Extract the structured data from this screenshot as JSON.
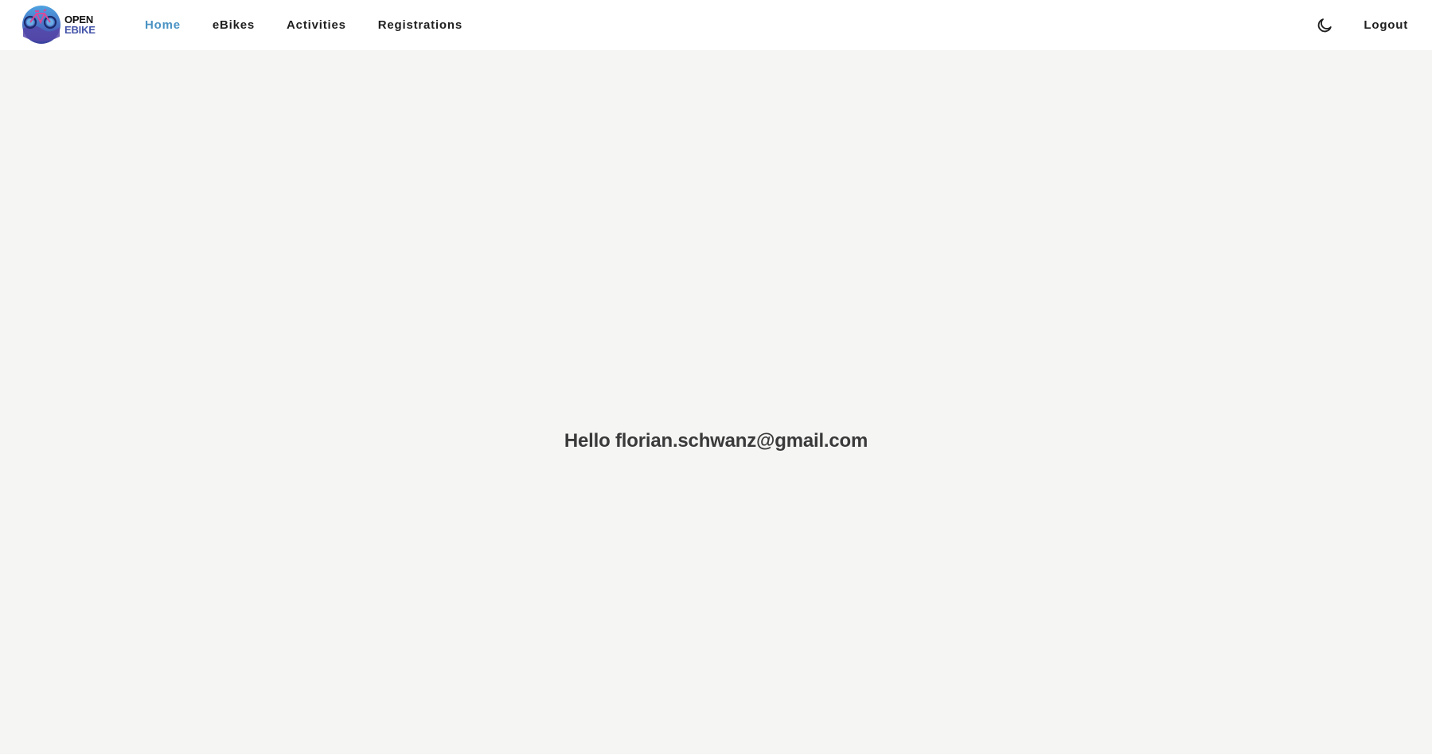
{
  "logo": {
    "line1": "OPEN",
    "line2": "EBIKE",
    "icon": "ebike-globe-logo"
  },
  "nav": {
    "items": [
      {
        "label": "Home",
        "active": true
      },
      {
        "label": "eBikes",
        "active": false
      },
      {
        "label": "Activities",
        "active": false
      },
      {
        "label": "Registrations",
        "active": false
      }
    ],
    "theme_toggle_icon": "moon-icon",
    "logout_label": "Logout"
  },
  "main": {
    "greeting": "Hello florian.schwanz@gmail.com"
  },
  "colors": {
    "accent": "#4a93c4",
    "background": "#f5f5f4",
    "navbar": "#ffffff",
    "text": "#1f1f1f",
    "logo_blue": "#4454a8"
  }
}
